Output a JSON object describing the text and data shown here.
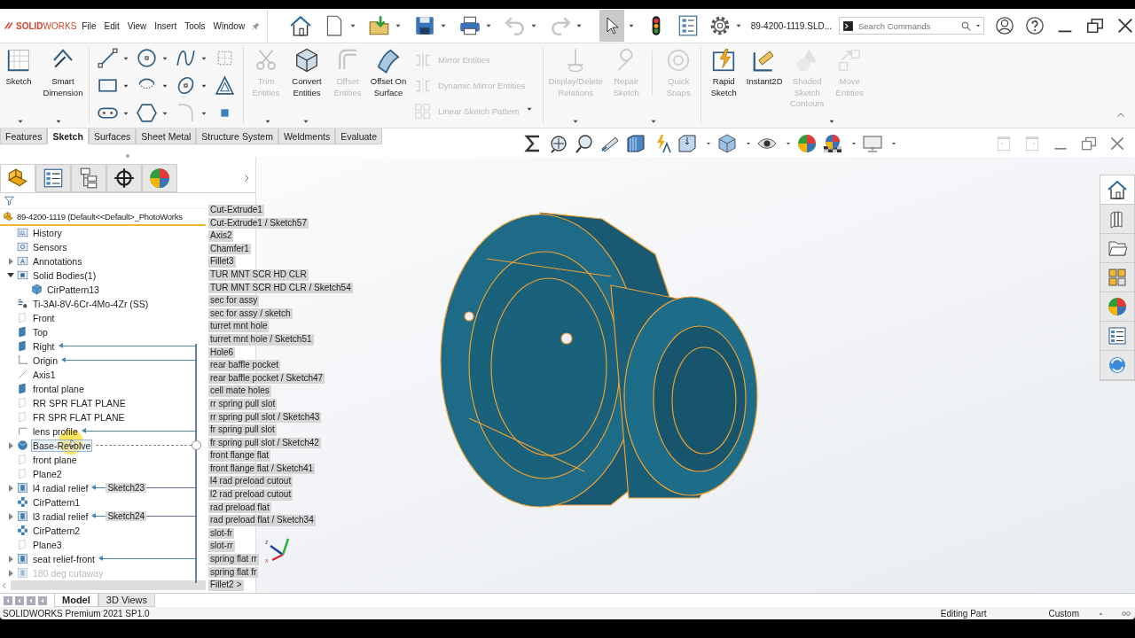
{
  "title_bar": {
    "logo": "**SOLID**WORKS",
    "menu": [
      "File",
      "Edit",
      "View",
      "Insert",
      "Tools",
      "Window"
    ],
    "file_name": "89-4200-1119.SLD...",
    "search": {
      "placeholder": "Search Commands"
    }
  },
  "ribbon": {
    "sketch_tools": [
      {
        "label": "Sketch",
        "disabled": false
      },
      {
        "label": "Smart Dimension",
        "disabled": false
      }
    ],
    "draw_tools": [
      {
        "disabled": false
      },
      {
        "disabled": false
      },
      {
        "disabled": false
      },
      {
        "disabled": false
      },
      {
        "disabled": false
      },
      {
        "disabled": false
      },
      {
        "disabled": false
      },
      {
        "disabled": false
      },
      {
        "disabled": false
      },
      {
        "disabled": false
      },
      {
        "disabled": true
      },
      {
        "disabled": false
      }
    ],
    "entity_tools": [
      {
        "label": "Trim Entities",
        "disabled": true
      },
      {
        "label": "Convert Entities",
        "disabled": false
      },
      {
        "label": "Offset Entities",
        "disabled": true
      },
      {
        "label": "Offset On Surface",
        "disabled": false
      }
    ],
    "pattern_tools": [
      {
        "label": "Mirror Entities",
        "disabled": true
      },
      {
        "label": "Dynamic Mirror Entities",
        "disabled": true
      },
      {
        "label": "Linear Sketch Pattern",
        "disabled": true
      }
    ],
    "relation_tools": [
      {
        "label": "Display/Delete Relations",
        "disabled": true
      },
      {
        "label": "Repair Sketch",
        "disabled": true
      },
      {
        "label": "Quick Snaps",
        "disabled": true
      }
    ],
    "quick_tools": [
      {
        "label": "Rapid Sketch",
        "disabled": false
      },
      {
        "label": "Instant2D",
        "disabled": false
      },
      {
        "label": "Shaded Sketch Contours",
        "disabled": true
      },
      {
        "label": "Move Entities",
        "disabled": true
      }
    ]
  },
  "command_tabs": [
    {
      "label": "Features",
      "selected": false
    },
    {
      "label": "Sketch",
      "selected": true
    },
    {
      "label": "Surfaces",
      "selected": false
    },
    {
      "label": "Sheet Metal",
      "selected": false
    },
    {
      "label": "Structure System",
      "selected": false
    },
    {
      "label": "Weldments",
      "selected": false
    },
    {
      "label": "Evaluate",
      "selected": false
    }
  ],
  "panel": {
    "tabs": [
      {
        "selected": true
      },
      {
        "selected": false
      },
      {
        "selected": false
      },
      {
        "selected": false
      },
      {
        "selected": false
      }
    ]
  },
  "tree": {
    "root": "89-4200-1119  (Default<<Default>_PhotoWorks",
    "items": [
      {
        "label": "History",
        "kind": "history",
        "expandable": false,
        "expanded": false,
        "selected": false,
        "disabled": false,
        "linked": false,
        "link_source": false
      },
      {
        "label": "Sensors",
        "kind": "sensor",
        "expandable": false,
        "expanded": false,
        "selected": false,
        "disabled": false,
        "linked": false,
        "link_source": false
      },
      {
        "label": "Annotations",
        "kind": "annotation",
        "expandable": true,
        "expanded": false,
        "selected": false,
        "disabled": false,
        "linked": false,
        "link_source": false
      },
      {
        "label": "Solid Bodies(1)",
        "kind": "bodies",
        "expandable": true,
        "expanded": true,
        "selected": false,
        "disabled": false,
        "linked": false,
        "link_source": false,
        "children": [
          {
            "label": "CirPattern13",
            "kind": "body",
            "expandable": false,
            "expanded": false,
            "selected": false,
            "disabled": false,
            "linked": false,
            "link_source": false
          }
        ]
      },
      {
        "label": "Ti-3Al-8V-6Cr-4Mo-4Zr (SS)",
        "kind": "material",
        "expandable": false,
        "expanded": false,
        "selected": false,
        "disabled": false,
        "linked": false,
        "link_source": false
      },
      {
        "label": "Front",
        "kind": "plane",
        "expandable": false,
        "expanded": false,
        "selected": false,
        "disabled": false,
        "linked": false,
        "link_source": false
      },
      {
        "label": "Top",
        "kind": "plane-shown",
        "expandable": false,
        "expanded": false,
        "selected": false,
        "disabled": false,
        "linked": false,
        "link_source": false
      },
      {
        "label": "Right",
        "kind": "plane-shown",
        "expandable": false,
        "expanded": false,
        "selected": false,
        "disabled": false,
        "linked": true,
        "link_source": false
      },
      {
        "label": "Origin",
        "kind": "origin",
        "expandable": false,
        "expanded": false,
        "selected": false,
        "disabled": false,
        "linked": true,
        "link_source": false
      },
      {
        "label": "Axis1",
        "kind": "axis",
        "expandable": false,
        "expanded": false,
        "selected": false,
        "disabled": false,
        "linked": false,
        "link_source": false
      },
      {
        "label": "frontal plane",
        "kind": "plane-shown",
        "expandable": false,
        "expanded": false,
        "selected": false,
        "disabled": false,
        "linked": false,
        "link_source": false
      },
      {
        "label": "RR SPR FLAT PLANE",
        "kind": "plane",
        "expandable": false,
        "expanded": false,
        "selected": false,
        "disabled": false,
        "linked": false,
        "link_source": false
      },
      {
        "label": "FR SPR FLAT PLANE",
        "kind": "plane",
        "expandable": false,
        "expanded": false,
        "selected": false,
        "disabled": false,
        "linked": false,
        "link_source": false
      },
      {
        "label": "lens profile",
        "kind": "sketch",
        "expandable": false,
        "expanded": false,
        "selected": false,
        "disabled": false,
        "linked": true,
        "link_source": false
      },
      {
        "label": "Base-Revolve",
        "kind": "revolve",
        "expandable": true,
        "expanded": false,
        "selected": true,
        "disabled": false,
        "linked": false,
        "link_source": true
      },
      {
        "label": "front plane",
        "kind": "plane",
        "expandable": false,
        "expanded": false,
        "selected": false,
        "disabled": false,
        "linked": false,
        "link_source": false
      },
      {
        "label": "Plane2",
        "kind": "plane",
        "expandable": false,
        "expanded": false,
        "selected": false,
        "disabled": false,
        "linked": false,
        "link_source": false
      },
      {
        "label": "l4 radial relief",
        "kind": "cut",
        "expandable": true,
        "expanded": false,
        "selected": false,
        "disabled": false,
        "linked": true,
        "link_source": false,
        "reference": "Sketch23"
      },
      {
        "label": "CirPattern1",
        "kind": "pattern",
        "expandable": false,
        "expanded": false,
        "selected": false,
        "disabled": false,
        "linked": false,
        "link_source": false
      },
      {
        "label": "l3 radial relief",
        "kind": "cut",
        "expandable": true,
        "expanded": false,
        "selected": false,
        "disabled": false,
        "linked": true,
        "link_source": false,
        "reference": "Sketch24"
      },
      {
        "label": "CirPattern2",
        "kind": "pattern",
        "expandable": false,
        "expanded": false,
        "selected": false,
        "disabled": false,
        "linked": false,
        "link_source": false
      },
      {
        "label": "Plane3",
        "kind": "plane",
        "expandable": false,
        "expanded": false,
        "selected": false,
        "disabled": false,
        "linked": false,
        "link_source": false
      },
      {
        "label": "seat relief-front",
        "kind": "cut",
        "expandable": true,
        "expanded": false,
        "selected": false,
        "disabled": false,
        "linked": true,
        "link_source": false
      },
      {
        "label": "180 deg cutaway",
        "kind": "cut",
        "expandable": true,
        "expanded": false,
        "selected": false,
        "disabled": true,
        "linked": false,
        "link_source": false
      }
    ]
  },
  "dependents": {
    "items": [
      "Cut-Extrude1",
      "Cut-Extrude1 / Sketch57",
      "Axis2",
      "Chamfer1",
      "Fillet3",
      "TUR MNT SCR HD CLR",
      "TUR MNT SCR HD CLR / Sketch54",
      "sec for assy",
      "sec for assy / sketch",
      "turret mnt hole",
      "turret mnt hole / Sketch51",
      "Hole6",
      "rear baffle pocket",
      "rear baffle pocket / Sketch47",
      "cell mate holes",
      "rr spring pull slot",
      "rr spring pull slot / Sketch43",
      "fr spring pull slot",
      "fr spring pull slot / Sketch42",
      "front flange flat",
      "front flange flat / Sketch41",
      "l4 rad preload cutout",
      "l2 rad preload cutout",
      "rad preload flat",
      "rad preload flat / Sketch34",
      "slot-fr",
      "slot-rr",
      "spring flat rr",
      "spring flat fr",
      "Fillet2"
    ],
    "more": ">"
  },
  "triad": {
    "labels": [
      "z",
      "x"
    ]
  },
  "bottom_tabs": [
    {
      "label": "Model",
      "selected": true
    },
    {
      "label": "3D Views",
      "selected": false
    }
  ],
  "status_bar": {
    "product": "SOLIDWORKS Premium 2021 SP1.0",
    "mode": "Editing Part",
    "units": "Custom"
  }
}
